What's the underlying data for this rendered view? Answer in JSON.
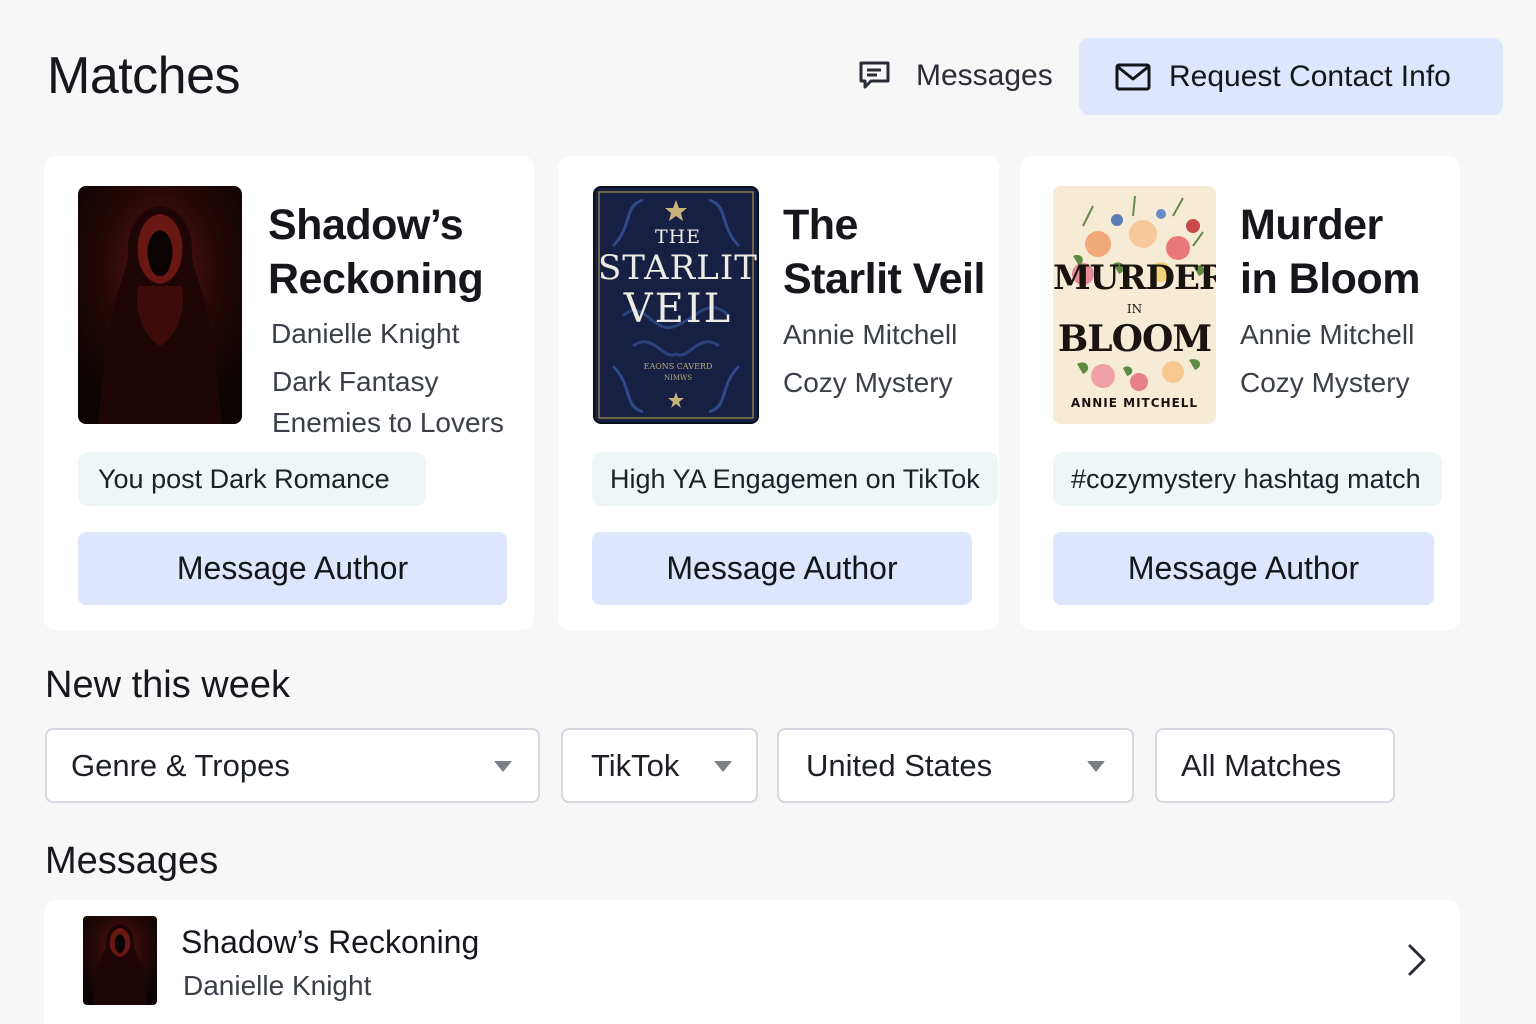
{
  "header": {
    "title": "Matches",
    "messages_label": "Messages",
    "request_label": "Request Contact Info"
  },
  "matches": [
    {
      "title_line1": "Shadow’s",
      "title_line2": "Reckoning",
      "author": "Danielle Knight",
      "genre": "Dark Fantasy",
      "trope": "Enemies to Lovers",
      "chip": "You post Dark Romance",
      "button": "Message Author"
    },
    {
      "title_line1": "The",
      "title_line2": "Starlit Veil",
      "author": "Annie Mitchell",
      "genre": "Cozy Mystery",
      "chip": "High YA Engagemen on TikTok",
      "button": "Message Author",
      "cover_text": {
        "line1": "THE",
        "line2": "STARLIT",
        "line3": "VEIL",
        "line4": "EAONS CAVERD",
        "line5": "NIMWS"
      }
    },
    {
      "title_line1": "Murder",
      "title_line2": "in Bloom",
      "author": "Annie Mitchell",
      "genre": "Cozy Mystery",
      "chip": "#cozymystery hashtag match",
      "button": "Message Author",
      "cover_text": {
        "line1": "MURDER",
        "line2": "IN",
        "line3": "BLOOM",
        "line4": "ANNIE MITCHELL"
      }
    }
  ],
  "new_this_week": {
    "title": "New this week",
    "filters": [
      "Genre & Tropes",
      "TikTok",
      "United States",
      "All Matches"
    ]
  },
  "messages": {
    "title": "Messages",
    "items": [
      {
        "title": "Shadow’s Reckoning",
        "author": "Danielle Knight"
      }
    ]
  },
  "colors": {
    "background": "#f7f7f8",
    "button_bg": "#dde6fc",
    "chip_bg": "#eef6f8",
    "card_bg": "#ffffff"
  },
  "icons": [
    "chat-icon",
    "mail-icon",
    "caret-down-icon",
    "chevron-right-icon"
  ]
}
